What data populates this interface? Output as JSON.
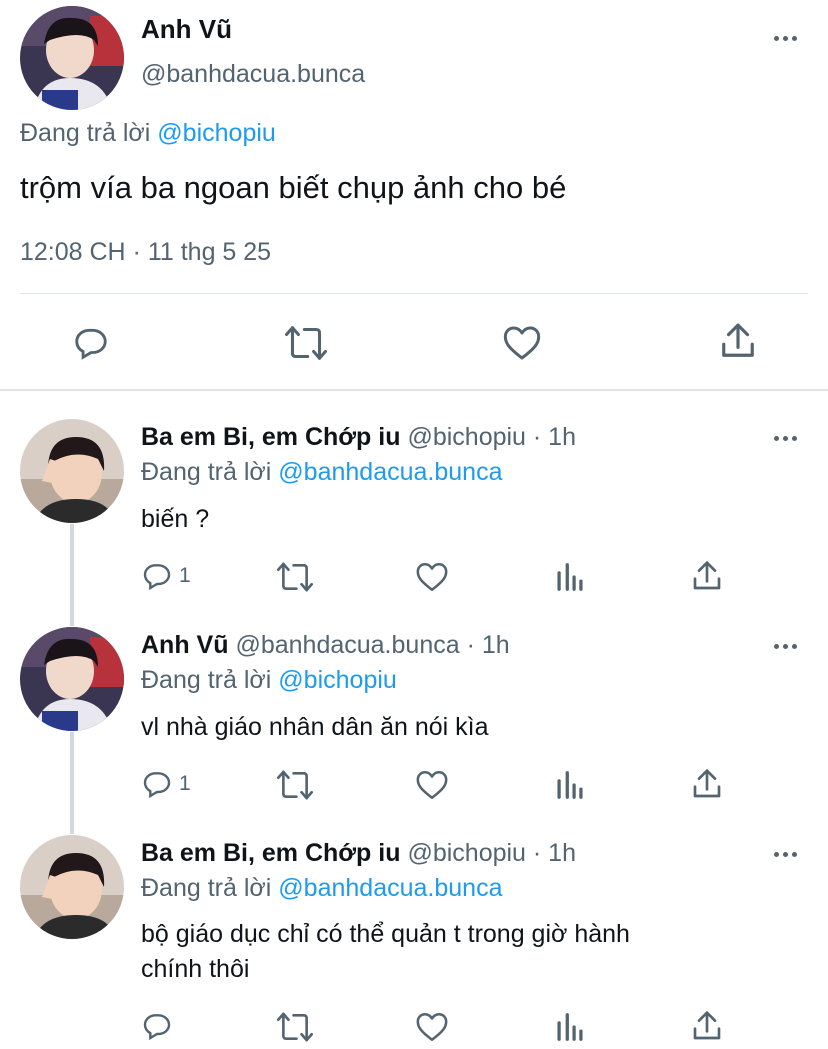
{
  "main_tweet": {
    "display_name": "Anh Vũ",
    "handle": "@banhdacua.bunca",
    "reply_prefix": "Đang trả lời",
    "reply_to": "@bichopiu",
    "text": "trộm vía ba ngoan biết chụp ảnh cho bé",
    "timestamp": "12:08 CH · 11 thg 5 25"
  },
  "replies": [
    {
      "display_name": "Ba em Bi, em Chớp iu",
      "handle_time": "@bichopiu · 1h",
      "reply_prefix": "Đang trả lời",
      "reply_to": "@banhdacua.bunca",
      "text": "biến ?",
      "reply_count": "1"
    },
    {
      "display_name": "Anh Vũ",
      "handle_time": "@banhdacua.bunca · 1h",
      "reply_prefix": "Đang trả lời",
      "reply_to": "@bichopiu",
      "text": "vl nhà giáo nhân dân ăn nói kìa",
      "reply_count": "1"
    },
    {
      "display_name": "Ba em Bi, em Chớp iu",
      "handle_time": "@bichopiu · 1h",
      "reply_prefix": "Đang trả lời",
      "reply_to": "@banhdacua.bunca",
      "text_line1": "bộ giáo dục chỉ có thể quản t trong giờ hành",
      "text_line2": "chính thôi"
    }
  ],
  "icons": [
    "reply-icon",
    "retweet-icon",
    "like-icon",
    "share-icon",
    "views-icon",
    "more-icon"
  ],
  "colors": {
    "link": "#1d9bf0",
    "secondary_text": "#536471",
    "divider": "#e1e6ea"
  }
}
